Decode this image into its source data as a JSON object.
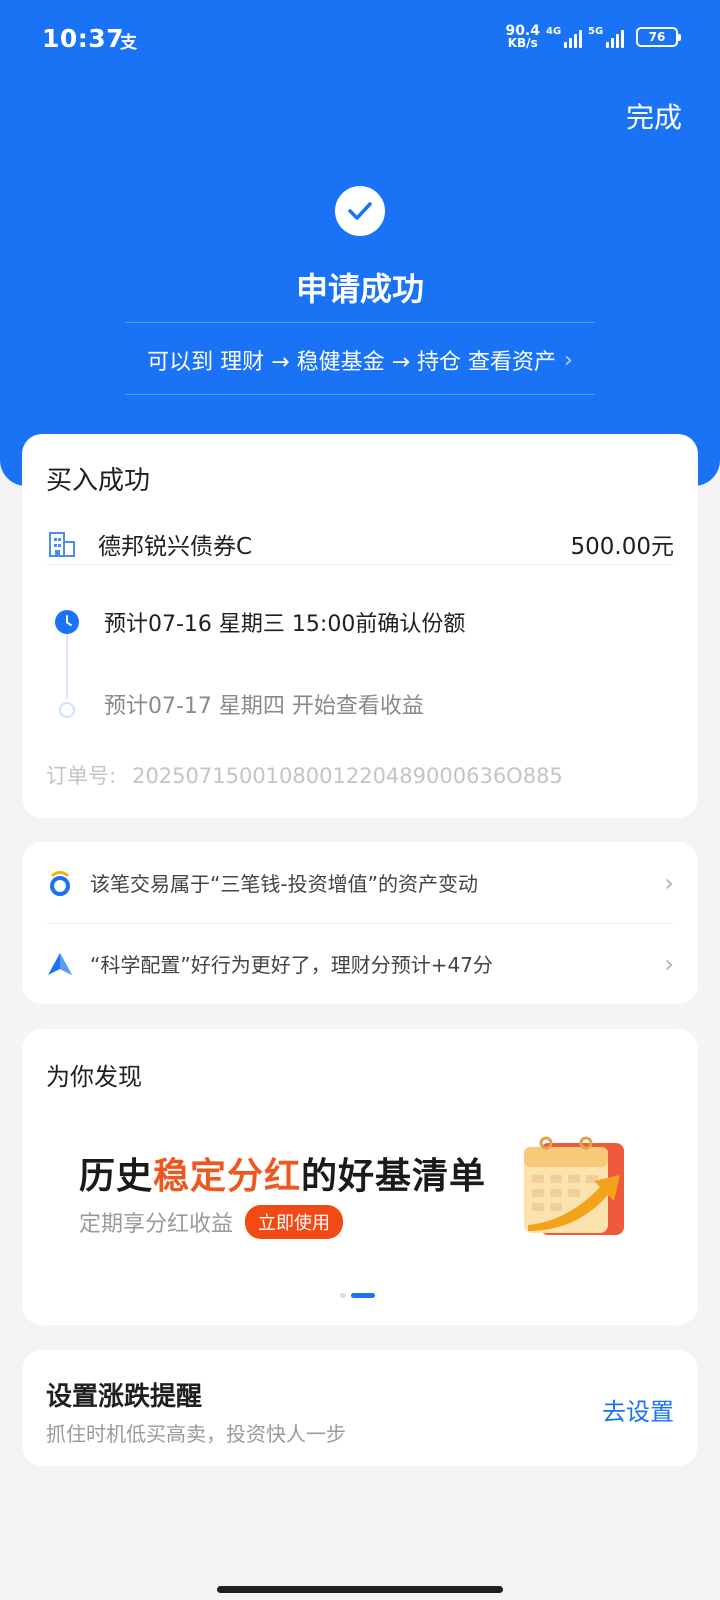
{
  "status_bar": {
    "time": "10:37",
    "app_indicator": "支",
    "net_speed_value": "90.4",
    "net_speed_unit": "KB/s",
    "signal1_label": "4G",
    "signal2_label": "5G",
    "battery": "76"
  },
  "header": {
    "done_label": "完成",
    "title": "申请成功",
    "link_text": "可以到 理财 → 稳健基金 → 持仓 查看资产",
    "link_chevron": "›"
  },
  "buy_card": {
    "title": "买入成功",
    "fund_name": "德邦锐兴债券C",
    "amount": "500.00元",
    "timeline": [
      {
        "text": "预计07-16 星期三 15:00前确认份额",
        "active": true
      },
      {
        "text": "预计07-17 星期四 开始查看收益",
        "active": false
      }
    ],
    "order_label": "订单号:",
    "order_number": "2025071500108001220489000636O885"
  },
  "info_card": {
    "items": [
      {
        "icon": "three-money-logo-icon",
        "text": "该笔交易属于“三笔钱-投资增值”的资产变动"
      },
      {
        "icon": "triangle-score-icon",
        "text": "“科学配置”好行为更好了，理财分预计+47分"
      }
    ]
  },
  "discover_card": {
    "title": "为你发现",
    "banner_head_prefix": "历史",
    "banner_head_highlight": "稳定分红",
    "banner_head_suffix": "的好基清单",
    "banner_sub": "定期享分红收益",
    "banner_button": "立即使用",
    "carousel_active_index": 1,
    "carousel_count": 2
  },
  "remind_card": {
    "title": "设置涨跌提醒",
    "subtitle": "抓住时机低买高卖，投资快人一步",
    "action": "去设置"
  },
  "colors": {
    "primary_blue": "#1a73f5",
    "highlight_orange": "#f0571f",
    "button_orange": "#f14a15",
    "background": "#f4f4f5"
  }
}
